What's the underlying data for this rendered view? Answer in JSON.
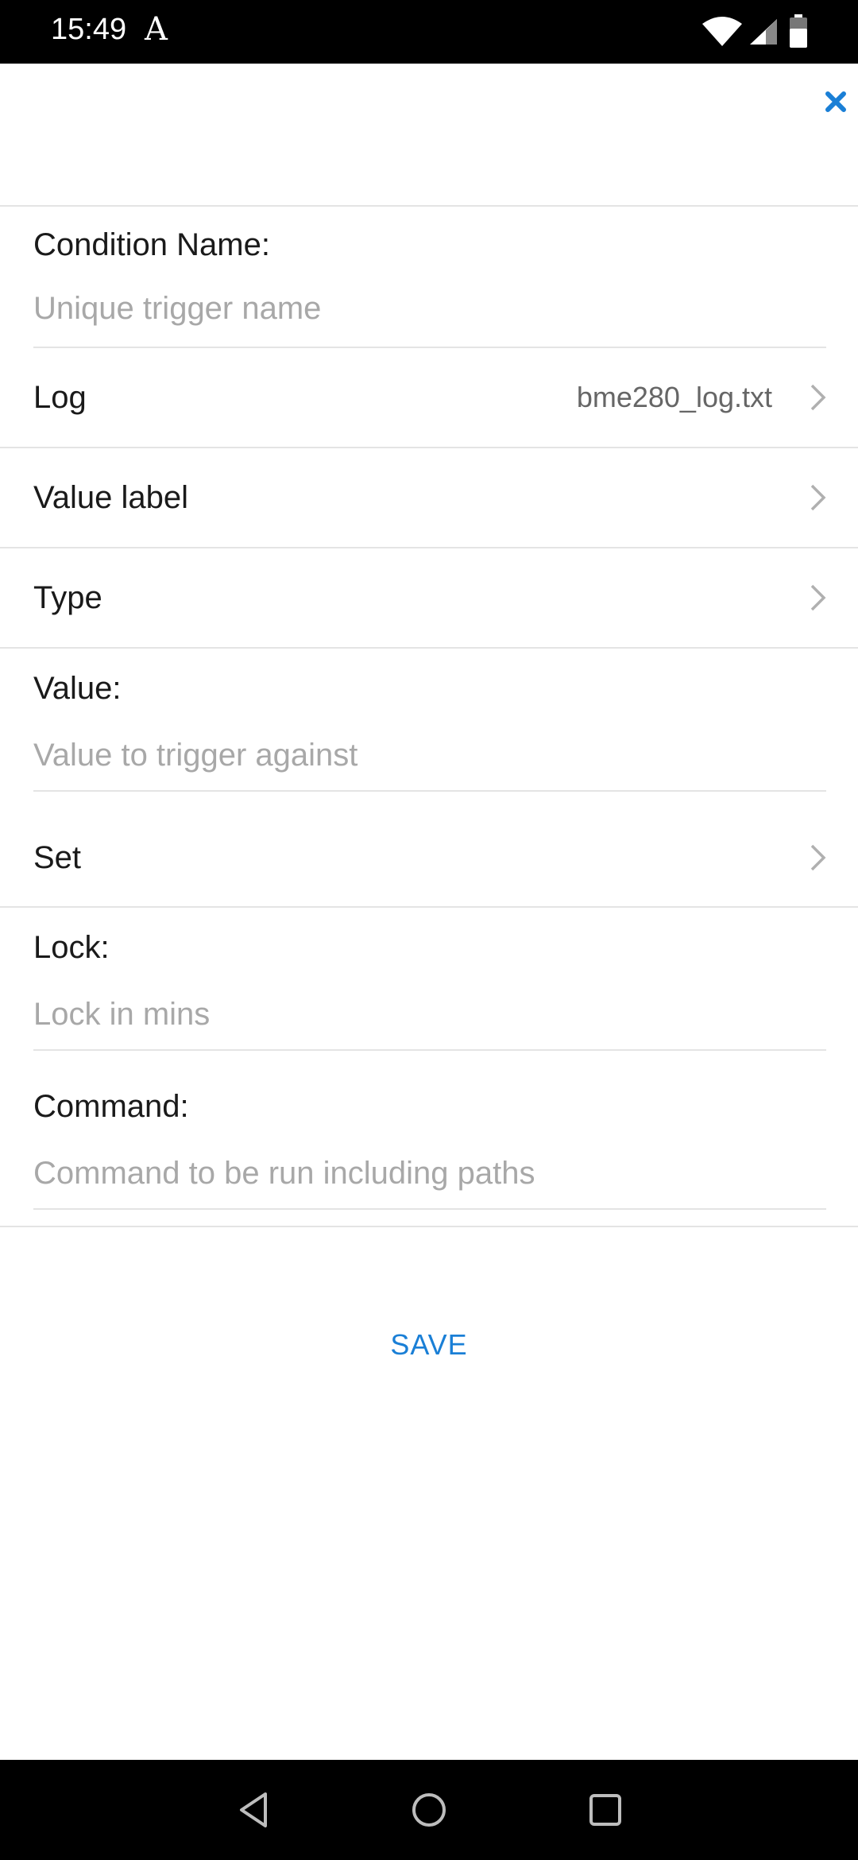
{
  "status_bar": {
    "time": "15:49",
    "font_indicator": "A",
    "icons": [
      "wifi-icon",
      "signal-icon",
      "battery-icon"
    ]
  },
  "header": {
    "close_icon": "close-icon",
    "accent_color": "#1a7fd6"
  },
  "form": {
    "condition_name": {
      "label": "Condition Name:",
      "placeholder": "Unique trigger name",
      "value": ""
    },
    "log": {
      "label": "Log",
      "value": "bme280_log.txt"
    },
    "value_label": {
      "label": "Value label",
      "value": ""
    },
    "type": {
      "label": "Type",
      "value": ""
    },
    "value": {
      "label": "Value:",
      "placeholder": "Value to trigger against",
      "value": ""
    },
    "set": {
      "label": "Set",
      "value": ""
    },
    "lock": {
      "label": "Lock:",
      "placeholder": "Lock in mins",
      "value": ""
    },
    "command": {
      "label": "Command:",
      "placeholder": "Command to be run including paths",
      "value": ""
    }
  },
  "actions": {
    "save_label": "SAVE"
  },
  "nav_bar": {
    "buttons": [
      "back-icon",
      "home-icon",
      "recents-icon"
    ]
  }
}
